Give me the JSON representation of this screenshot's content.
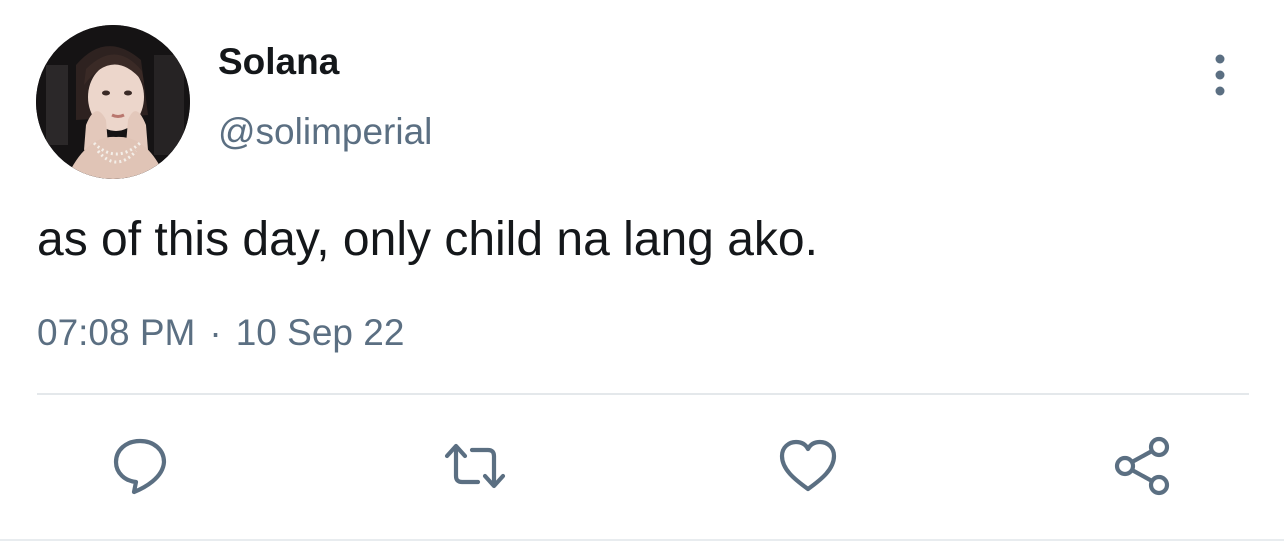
{
  "tweet": {
    "display_name": "Solana",
    "handle": "@solimperial",
    "text": "as of this day, only child na lang ako.",
    "time": "07:08 PM",
    "separator": "·",
    "date": "10 Sep 22"
  },
  "icons": {
    "more": "more-vertical-icon",
    "reply": "comment-icon",
    "retweet": "retweet-icon",
    "like": "heart-icon",
    "share": "share-icon"
  },
  "colors": {
    "text_primary": "#14171a",
    "text_secondary": "#5b6f82",
    "icon": "#5b6f82",
    "divider": "#e4e8eb"
  }
}
